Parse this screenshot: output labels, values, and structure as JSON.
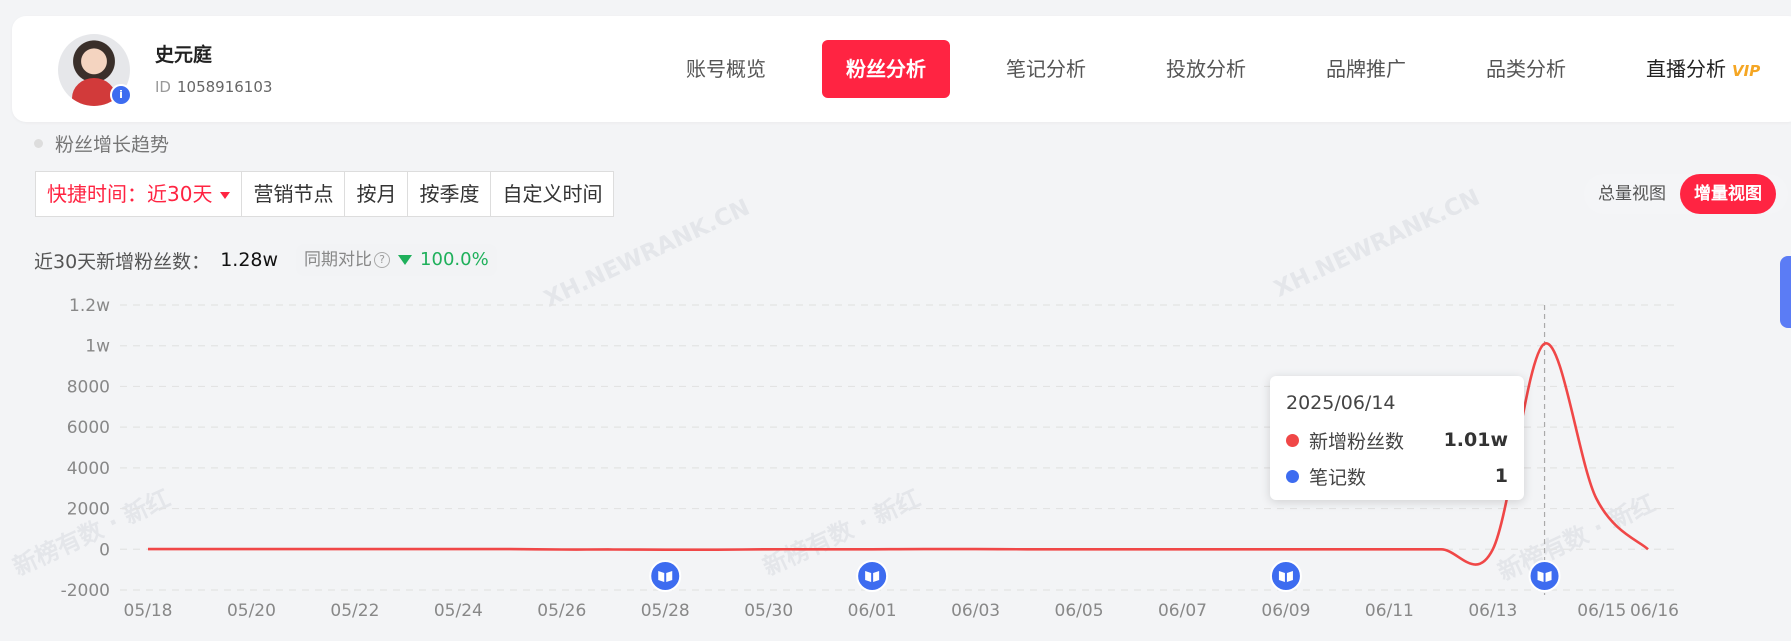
{
  "account": {
    "name": "史元庭",
    "id_label": "ID",
    "id_value": "1058916103"
  },
  "nav": [
    {
      "label": "账号概览",
      "active": false
    },
    {
      "label": "粉丝分析",
      "active": true
    },
    {
      "label": "笔记分析",
      "active": false
    },
    {
      "label": "投放分析",
      "active": false
    },
    {
      "label": "品牌推广",
      "active": false
    },
    {
      "label": "品类分析",
      "active": false
    },
    {
      "label": "直播分析",
      "active": false
    }
  ],
  "nav_vip_badge": "VIP",
  "section_title": "粉丝增长趋势",
  "filters": {
    "quick_label": "快捷时间：近30天",
    "marketing": "营销节点",
    "monthly": "按月",
    "quarterly": "按季度",
    "custom": "自定义时间"
  },
  "views": {
    "total": "总量视图",
    "increment": "增量视图"
  },
  "stats": {
    "label": "近30天新增粉丝数：",
    "value": "1.28w",
    "yoy_label": "同期对比",
    "yoy_value": "100.0%"
  },
  "watermarks": [
    "XH.NEWRANK.CN",
    "新榜有数 · 新红"
  ],
  "tooltip": {
    "date": "2025/06/14",
    "rows": [
      {
        "name": "新增粉丝数",
        "value": "1.01w",
        "color": "#f04747"
      },
      {
        "name": "笔记数",
        "value": "1",
        "color": "#3d6cf0"
      }
    ]
  },
  "colors": {
    "brand": "#ff2442",
    "line": "#f04747",
    "note_marker": "#3d6cf0",
    "up_down": "#1fb05b"
  },
  "chart_data": {
    "type": "line",
    "x_ticks": [
      "05/18",
      "05/20",
      "05/22",
      "05/24",
      "05/26",
      "05/28",
      "05/30",
      "06/01",
      "06/03",
      "06/05",
      "06/07",
      "06/09",
      "06/11",
      "06/13",
      "06/15",
      "06/16"
    ],
    "y_ticks": [
      {
        "value": -2000,
        "label": "-2000"
      },
      {
        "value": 0,
        "label": "0"
      },
      {
        "value": 2000,
        "label": "2000"
      },
      {
        "value": 4000,
        "label": "4000"
      },
      {
        "value": 6000,
        "label": "6000"
      },
      {
        "value": 8000,
        "label": "8000"
      },
      {
        "value": 10000,
        "label": "1w"
      },
      {
        "value": 12000,
        "label": "1.2w"
      }
    ],
    "ylim": [
      -2000,
      12000
    ],
    "grid": true,
    "series": [
      {
        "name": "新增粉丝数",
        "x": [
          "05/18",
          "05/19",
          "05/20",
          "05/21",
          "05/22",
          "05/23",
          "05/24",
          "05/25",
          "05/26",
          "05/27",
          "05/28",
          "05/29",
          "05/30",
          "05/31",
          "06/01",
          "06/02",
          "06/03",
          "06/04",
          "06/05",
          "06/06",
          "06/07",
          "06/08",
          "06/09",
          "06/10",
          "06/11",
          "06/12",
          "06/13",
          "06/14",
          "06/15",
          "06/16"
        ],
        "values": [
          10,
          10,
          10,
          10,
          10,
          10,
          10,
          10,
          -10,
          -10,
          -20,
          -20,
          0,
          0,
          0,
          10,
          10,
          0,
          0,
          0,
          0,
          0,
          0,
          0,
          0,
          0,
          0,
          10100,
          2500,
          0
        ]
      },
      {
        "name": "笔记数",
        "marker_dates": [
          "05/28",
          "06/01",
          "06/09",
          "06/14"
        ]
      }
    ],
    "tooltip_date_index": 27
  }
}
